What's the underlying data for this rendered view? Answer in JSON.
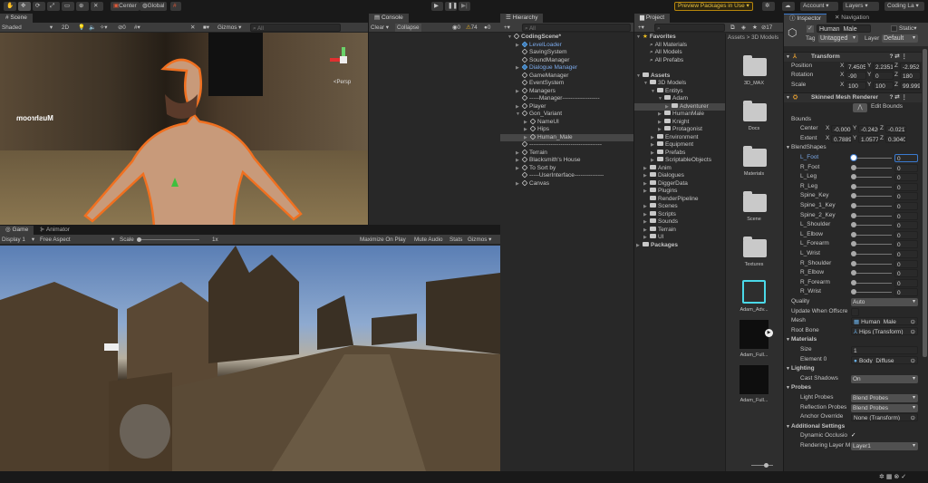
{
  "toolbar": {
    "center": "Center",
    "global": "Global",
    "preview": "Preview Packages in Use",
    "account": "Account",
    "layers": "Layers",
    "layout": "Coding La"
  },
  "scene": {
    "tab": "Scene",
    "shading": "Shaded",
    "mode2d": "2D",
    "hidden_count": "0",
    "gizmos": "Gizmos",
    "search_placeholder": "All",
    "persp": "<Persp",
    "sign": "Mushroom"
  },
  "console": {
    "tab": "Console",
    "clear": "Clear",
    "collapse": "Collapse",
    "info_count": "0",
    "warn_count": "74",
    "error_count": "0"
  },
  "game": {
    "tab": "Game",
    "animator_tab": "Animator",
    "display": "Display 1",
    "aspect": "Free Aspect",
    "scale_label": "Scale",
    "scale_value": "1x",
    "maximize": "Maximize On Play",
    "mute": "Mute Audio",
    "stats": "Stats",
    "gizmos": "Gizmos"
  },
  "hierarchy": {
    "tab": "Hierarchy",
    "search_placeholder": "All",
    "items": [
      {
        "label": "CodingScene*",
        "depth": 0,
        "arrow": "▼",
        "kind": "scene"
      },
      {
        "label": "LevelLoader",
        "depth": 1,
        "arrow": "▶",
        "kind": "prefab"
      },
      {
        "label": "SavingSystem",
        "depth": 1,
        "arrow": "",
        "kind": "obj"
      },
      {
        "label": "SoundManager",
        "depth": 1,
        "arrow": "",
        "kind": "obj"
      },
      {
        "label": "Dialogue Manager",
        "depth": 1,
        "arrow": "▶",
        "kind": "prefab"
      },
      {
        "label": "GameManager",
        "depth": 1,
        "arrow": "",
        "kind": "obj"
      },
      {
        "label": "EventSystem",
        "depth": 1,
        "arrow": "",
        "kind": "obj"
      },
      {
        "label": "Managers",
        "depth": 1,
        "arrow": "▶",
        "kind": "obj"
      },
      {
        "label": "-----Manager-------------------",
        "depth": 1,
        "arrow": "",
        "kind": "obj"
      },
      {
        "label": "Player",
        "depth": 1,
        "arrow": "▶",
        "kind": "obj"
      },
      {
        "label": "Gon_Variant",
        "depth": 1,
        "arrow": "▼",
        "kind": "obj"
      },
      {
        "label": "NameUI",
        "depth": 2,
        "arrow": "▶",
        "kind": "obj"
      },
      {
        "label": "Hips",
        "depth": 2,
        "arrow": "▶",
        "kind": "obj"
      },
      {
        "label": "Human_Male",
        "depth": 2,
        "arrow": "▶",
        "kind": "obj",
        "selected": true
      },
      {
        "label": "-------------------------------------",
        "depth": 1,
        "arrow": "",
        "kind": "obj"
      },
      {
        "label": "Terrain",
        "depth": 1,
        "arrow": "▶",
        "kind": "obj"
      },
      {
        "label": "Blacksmith's House",
        "depth": 1,
        "arrow": "▶",
        "kind": "obj"
      },
      {
        "label": "To Sort by",
        "depth": 1,
        "arrow": "▶",
        "kind": "obj"
      },
      {
        "label": "-----UserInterface---------------",
        "depth": 1,
        "arrow": "",
        "kind": "obj"
      },
      {
        "label": "Canvas",
        "depth": 1,
        "arrow": "▶",
        "kind": "obj"
      }
    ]
  },
  "project": {
    "tab": "Project",
    "hidden_count": "17",
    "breadcrumb": [
      "Assets",
      "3D Models"
    ],
    "tree": [
      {
        "label": "Favorites",
        "depth": 0,
        "arrow": "▼",
        "kind": "star"
      },
      {
        "label": "All Materials",
        "depth": 1,
        "arrow": "",
        "kind": "search"
      },
      {
        "label": "All Models",
        "depth": 1,
        "arrow": "",
        "kind": "search"
      },
      {
        "label": "All Prefabs",
        "depth": 1,
        "arrow": "",
        "kind": "search"
      },
      {
        "label": "",
        "depth": 0,
        "arrow": "",
        "kind": "blank"
      },
      {
        "label": "Assets",
        "depth": 0,
        "arrow": "▼",
        "kind": "folder"
      },
      {
        "label": "3D Models",
        "depth": 1,
        "arrow": "▼",
        "kind": "folder"
      },
      {
        "label": "Entitys",
        "depth": 2,
        "arrow": "▼",
        "kind": "folder"
      },
      {
        "label": "Adam",
        "depth": 3,
        "arrow": "▼",
        "kind": "folder"
      },
      {
        "label": "Adventurer",
        "depth": 4,
        "arrow": "▶",
        "kind": "folder",
        "selected": true
      },
      {
        "label": "HumanMale",
        "depth": 3,
        "arrow": "▶",
        "kind": "folder"
      },
      {
        "label": "Knight",
        "depth": 3,
        "arrow": "▶",
        "kind": "folder"
      },
      {
        "label": "Protagonist",
        "depth": 3,
        "arrow": "▶",
        "kind": "folder"
      },
      {
        "label": "Environment",
        "depth": 2,
        "arrow": "▶",
        "kind": "folder"
      },
      {
        "label": "Equipment",
        "depth": 2,
        "arrow": "▶",
        "kind": "folder"
      },
      {
        "label": "Prefabs",
        "depth": 2,
        "arrow": "▶",
        "kind": "folder"
      },
      {
        "label": "ScriptableObjects",
        "depth": 2,
        "arrow": "▶",
        "kind": "folder"
      },
      {
        "label": "Anim",
        "depth": 1,
        "arrow": "▶",
        "kind": "folder"
      },
      {
        "label": "Dialogues",
        "depth": 1,
        "arrow": "▶",
        "kind": "folder"
      },
      {
        "label": "DiggerData",
        "depth": 1,
        "arrow": "▶",
        "kind": "folder"
      },
      {
        "label": "Plugins",
        "depth": 1,
        "arrow": "▶",
        "kind": "folder"
      },
      {
        "label": "RenderPipeline",
        "depth": 1,
        "arrow": "",
        "kind": "folder"
      },
      {
        "label": "Scenes",
        "depth": 1,
        "arrow": "▶",
        "kind": "folder"
      },
      {
        "label": "Scripts",
        "depth": 1,
        "arrow": "▶",
        "kind": "folder"
      },
      {
        "label": "Sounds",
        "depth": 1,
        "arrow": "▶",
        "kind": "folder"
      },
      {
        "label": "Terrain",
        "depth": 1,
        "arrow": "▶",
        "kind": "folder"
      },
      {
        "label": "UI",
        "depth": 1,
        "arrow": "▶",
        "kind": "folder"
      },
      {
        "label": "Packages",
        "depth": 0,
        "arrow": "▶",
        "kind": "folder"
      }
    ],
    "grid": [
      {
        "label": "3D_MAX",
        "kind": "folder"
      },
      {
        "label": "Docs",
        "kind": "folder"
      },
      {
        "label": "Materials",
        "kind": "folder"
      },
      {
        "label": "Scene",
        "kind": "folder"
      },
      {
        "label": "Textures",
        "kind": "folder"
      },
      {
        "label": "Adam_Adv...",
        "kind": "prefab"
      },
      {
        "label": "Adam_Full...",
        "kind": "model"
      },
      {
        "label": "Adam_Full...",
        "kind": "model"
      }
    ]
  },
  "inspector": {
    "tab": "Inspector",
    "nav_tab": "Navigation",
    "name": "Human_Male",
    "static": "Static",
    "tag_label": "Tag",
    "tag": "Untagged",
    "layer_label": "Layer",
    "layer": "Default",
    "transform": {
      "title": "Transform",
      "rows": [
        {
          "label": "Position",
          "x": "7.4505",
          "y": "2.2351",
          "z": "-2.952"
        },
        {
          "label": "Rotation",
          "x": "-90",
          "y": "0",
          "z": "180"
        },
        {
          "label": "Scale",
          "x": "100",
          "y": "100",
          "z": "99.999"
        }
      ]
    },
    "smr": {
      "title": "Skinned Mesh Renderer",
      "edit_bounds": "Edit Bounds",
      "bounds": "Bounds",
      "bounds_rows": [
        {
          "label": "Center",
          "x": "-0.000",
          "y": "-0.2420",
          "z": "-0.0217"
        },
        {
          "label": "Extent",
          "x": "0.7889",
          "y": "1.0577",
          "z": "0.3040"
        }
      ],
      "blendshapes_label": "BlendShapes",
      "blendshapes": [
        {
          "label": "L_Foot",
          "value": "0"
        },
        {
          "label": "R_Foot",
          "value": "0"
        },
        {
          "label": "L_Leg",
          "value": "0"
        },
        {
          "label": "R_Leg",
          "value": "0"
        },
        {
          "label": "Spine_Key",
          "value": "0"
        },
        {
          "label": "Spine_1_Key",
          "value": "0"
        },
        {
          "label": "Spine_2_Key",
          "value": "0"
        },
        {
          "label": "L_Shoulder",
          "value": "0"
        },
        {
          "label": "L_Elbow",
          "value": "0"
        },
        {
          "label": "L_Forearm",
          "value": "0"
        },
        {
          "label": "L_Wrist",
          "value": "0"
        },
        {
          "label": "R_Shoulder",
          "value": "0"
        },
        {
          "label": "R_Elbow",
          "value": "0"
        },
        {
          "label": "R_Forearm",
          "value": "0"
        },
        {
          "label": "R_Wrist",
          "value": "0"
        }
      ],
      "quality_label": "Quality",
      "quality": "Auto",
      "offscreen_label": "Update When Offscre",
      "mesh_label": "Mesh",
      "mesh": "Human_Male",
      "root_label": "Root Bone",
      "root": "Hips (Transform)",
      "materials": "Materials",
      "size_label": "Size",
      "size": "1",
      "element_label": "Element 0",
      "element": "Body_Diffuse",
      "lighting": "Lighting",
      "shadows_label": "Cast Shadows",
      "shadows": "On",
      "probes": "Probes",
      "light_probes_label": "Light Probes",
      "light_probes": "Blend Probes",
      "refl_label": "Reflection Probes",
      "refl": "Blend Probes",
      "anchor_label": "Anchor Override",
      "anchor": "None (Transform)",
      "additional": "Additional Settings",
      "dyn_label": "Dynamic Occlusio",
      "render_label": "Rendering Layer M",
      "render": "Layer1"
    }
  }
}
